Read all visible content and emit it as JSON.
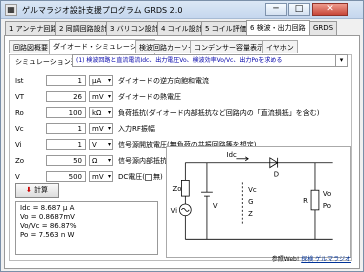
{
  "window": {
    "title": "ゲルマラジオ設計支援プログラム GRDS 2.0",
    "minimize": "─",
    "maximize": "□",
    "close": "✕"
  },
  "main_tabs": [
    {
      "label": "1 アンテナ回路"
    },
    {
      "label": "2 同調回路設計"
    },
    {
      "label": "3 バリコン設計"
    },
    {
      "label": "4 コイル設計"
    },
    {
      "label": "5 コイル評価"
    },
    {
      "label": "6 検波・出力回路"
    },
    {
      "label": "GRDS"
    }
  ],
  "sub_tabs": [
    {
      "label": "回路図概要"
    },
    {
      "label": "ダイオード・シミュレーション"
    },
    {
      "label": "検波回路カーソード"
    },
    {
      "label": "コンデンサー容量表示"
    },
    {
      "label": "イヤホン"
    }
  ],
  "simulation": {
    "label": "シミュレーション選択",
    "selected_prefix": "(1)",
    "selected": "検波回路と直流電流Idc、出力電圧Vo、検波効率Vo/Vc、出力Poを求める"
  },
  "params": [
    {
      "sym": "Ist",
      "value": "1",
      "unit": "μA",
      "desc": "ダイオードの逆方向飽和電流"
    },
    {
      "sym": "VT",
      "value": "26",
      "unit": "mV",
      "desc": "ダイオードの熱電圧"
    },
    {
      "sym": "Ro",
      "value": "100",
      "unit": "kΩ",
      "desc": "負荷抵抗(ダイオード内部抵抗など回路内の「直流損抵」を含む)"
    },
    {
      "sym": "Vc",
      "value": "1",
      "unit": "mV",
      "desc": "入力RF振幅"
    },
    {
      "sym": "Vi",
      "value": "1",
      "unit": "V",
      "desc": "信号源開放電圧(無負荷の共振回路等を想定)"
    },
    {
      "sym": "Zo",
      "value": "50",
      "unit": "Ω",
      "desc": "信号源内部抵抗"
    },
    {
      "sym": "V",
      "value": "500",
      "unit": "mV",
      "desc": "DC電圧(",
      "check_label": "無)"
    }
  ],
  "calc_button": {
    "arrow": "⬇",
    "label": "計算"
  },
  "results": [
    "Idc = 8.687 μ A",
    "Vo = 0.8687mV",
    "Vo/Vc = 86.87%",
    "Po = 7.563 n W"
  ],
  "circuit": {
    "label_idc": "Idc",
    "label_d": "D",
    "label_zo": "Zo",
    "label_vi": "Vi",
    "label_v": "V",
    "label_vc": "Vc",
    "label_g": "G",
    "label_z": "Z",
    "label_r": "R",
    "label_vo": "Vo",
    "label_po": "Po"
  },
  "footer": {
    "text": "参照Web!",
    "link": "探検 ゲルマラジオ"
  }
}
